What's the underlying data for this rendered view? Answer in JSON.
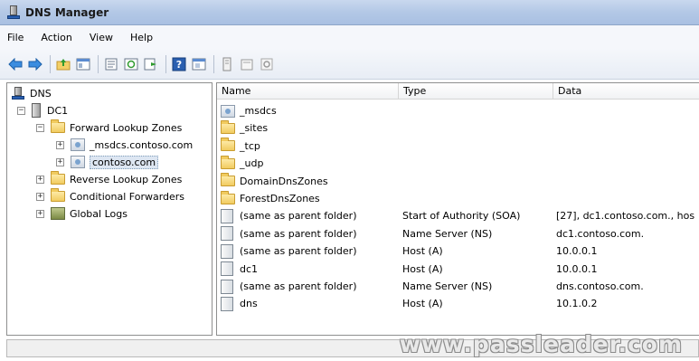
{
  "window": {
    "title": "DNS Manager"
  },
  "menu": [
    "File",
    "Action",
    "View",
    "Help"
  ],
  "toolbar": {
    "icons": [
      "back-arrow-icon",
      "forward-arrow-icon",
      "up-folder-icon",
      "console-tree-icon",
      "properties-icon",
      "refresh-icon",
      "export-list-icon",
      "help-icon",
      "window-icon",
      "record-icon",
      "folder-page-icon",
      "gear-icon"
    ]
  },
  "tree": {
    "root": "DNS",
    "server": "DC1",
    "forward_zones": "Forward Lookup Zones",
    "msdcs_zone": "_msdcs.contoso.com",
    "contoso_zone": "contoso.com",
    "reverse_zones": "Reverse Lookup Zones",
    "conditional_forwarders": "Conditional Forwarders",
    "global_logs": "Global Logs",
    "expand_minus": "−",
    "expand_plus": "+"
  },
  "list": {
    "headers": {
      "name": "Name",
      "type": "Type",
      "data": "Data"
    },
    "rows": [
      {
        "name": "_msdcs",
        "type": "",
        "data": "",
        "icon": "zone-delegation-icon"
      },
      {
        "name": "_sites",
        "type": "",
        "data": "",
        "icon": "folder-icon"
      },
      {
        "name": "_tcp",
        "type": "",
        "data": "",
        "icon": "folder-icon"
      },
      {
        "name": "_udp",
        "type": "",
        "data": "",
        "icon": "folder-icon"
      },
      {
        "name": "DomainDnsZones",
        "type": "",
        "data": "",
        "icon": "folder-icon"
      },
      {
        "name": "ForestDnsZones",
        "type": "",
        "data": "",
        "icon": "folder-icon"
      },
      {
        "name": "(same as parent folder)",
        "type": "Start of Authority (SOA)",
        "data": "[27], dc1.contoso.com., hos",
        "icon": "record-icon"
      },
      {
        "name": "(same as parent folder)",
        "type": "Name Server (NS)",
        "data": "dc1.contoso.com.",
        "icon": "record-icon"
      },
      {
        "name": "(same as parent folder)",
        "type": "Host (A)",
        "data": "10.0.0.1",
        "icon": "record-icon"
      },
      {
        "name": "dc1",
        "type": "Host (A)",
        "data": "10.0.0.1",
        "icon": "record-icon"
      },
      {
        "name": "(same as parent folder)",
        "type": "Name Server (NS)",
        "data": "dns.contoso.com.",
        "icon": "record-icon"
      },
      {
        "name": "dns",
        "type": "Host (A)",
        "data": "10.1.0.2",
        "icon": "record-icon"
      }
    ]
  },
  "watermark": "www.passleader.com"
}
